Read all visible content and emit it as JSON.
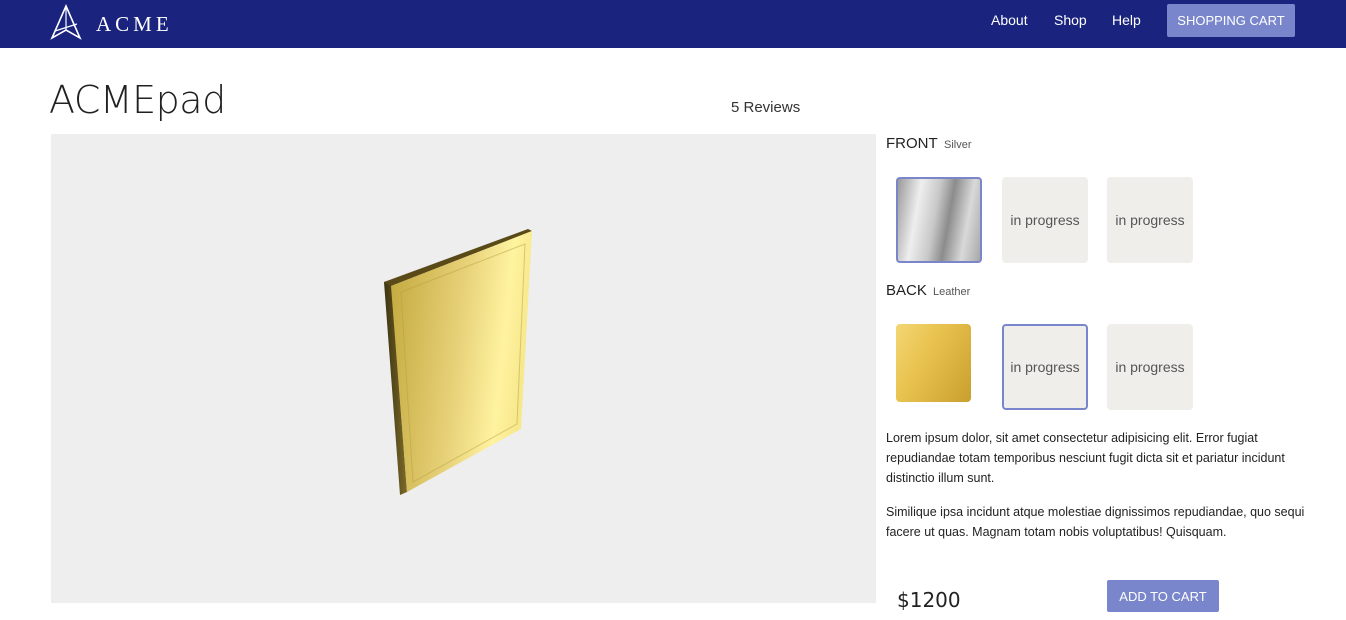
{
  "brand": {
    "name": "ACME",
    "logo_icon": "acme-triangle-logo"
  },
  "nav": {
    "links": [
      "About",
      "Shop",
      "Help"
    ],
    "cart_label": "SHOPPING CART"
  },
  "product": {
    "title": "ACMEpad",
    "reviews": "5 Reviews",
    "price": "$1200",
    "add_to_cart_label": "ADD TO CART"
  },
  "options": {
    "front": {
      "label": "FRONT",
      "selected": "Silver",
      "swatches": [
        {
          "text": "",
          "material": "silver",
          "selected": true
        },
        {
          "text": "in progress",
          "selected": false
        },
        {
          "text": "in progress",
          "selected": false
        }
      ]
    },
    "back": {
      "label": "BACK",
      "selected": "Leather",
      "swatches": [
        {
          "text": "",
          "material": "gold",
          "selected": false
        },
        {
          "text": "in progress",
          "selected": true
        },
        {
          "text": "in progress",
          "selected": false
        }
      ]
    }
  },
  "description": [
    "Lorem ipsum dolor, sit amet consectetur adipisicing elit. Error fugiat repudiandae totam temporibus nesciunt fugit dicta sit et pariatur incidunt distinctio illum sunt.",
    "Similique ipsa incidunt atque molestiae dignissimos repudiandae, quo sequi facere ut quas. Magnam totam nobis voluptatibus! Quisquam."
  ],
  "colors": {
    "navbar": "#1a237e",
    "accent": "#7986cb",
    "viewer_bg": "#eeeeee"
  }
}
